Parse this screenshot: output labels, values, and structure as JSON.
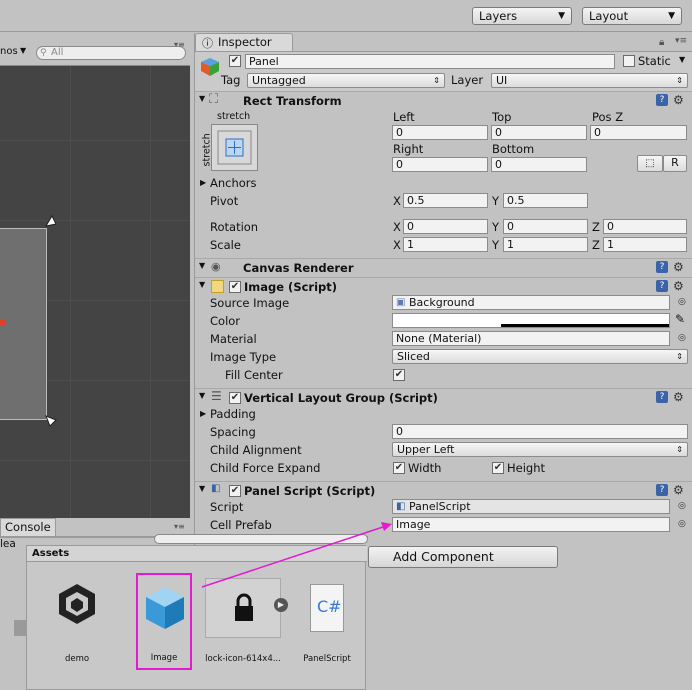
{
  "toolbar": {
    "layers_label": "Layers",
    "layout_label": "Layout"
  },
  "scene": {
    "gizmos_label": "nos",
    "search_placeholder": "All"
  },
  "inspector": {
    "tab_label": "Inspector",
    "object_name": "Panel",
    "static_label": "Static",
    "tag_label": "Tag",
    "tag_value": "Untagged",
    "layer_label": "Layer",
    "layer_value": "UI"
  },
  "rect_transform": {
    "title": "Rect Transform",
    "preset_top": "stretch",
    "preset_side": "stretch",
    "left_label": "Left",
    "left_value": "0",
    "top_label": "Top",
    "top_value": "0",
    "posz_label": "Pos Z",
    "posz_value": "0",
    "right_label": "Right",
    "right_value": "0",
    "bottom_label": "Bottom",
    "bottom_value": "0",
    "r_button": "R",
    "anchors_label": "Anchors",
    "pivot_label": "Pivot",
    "pivot_x": "0.5",
    "pivot_y": "0.5",
    "rotation_label": "Rotation",
    "rot_x": "0",
    "rot_y": "0",
    "rot_z": "0",
    "scale_label": "Scale",
    "scale_x": "1",
    "scale_y": "1",
    "scale_z": "1",
    "x": "X",
    "y": "Y",
    "z": "Z"
  },
  "canvas_renderer": {
    "title": "Canvas Renderer"
  },
  "image": {
    "title": "Image (Script)",
    "source_label": "Source Image",
    "source_value": "Background",
    "color_label": "Color",
    "material_label": "Material",
    "material_value": "None (Material)",
    "type_label": "Image Type",
    "type_value": "Sliced",
    "fill_label": "Fill Center"
  },
  "vlg": {
    "title": "Vertical Layout Group (Script)",
    "padding_label": "Padding",
    "spacing_label": "Spacing",
    "spacing_value": "0",
    "align_label": "Child Alignment",
    "align_value": "Upper Left",
    "expand_label": "Child Force Expand",
    "width_label": "Width",
    "height_label": "Height"
  },
  "panel_script": {
    "title": "Panel Script (Script)",
    "script_label": "Script",
    "script_value": "PanelScript",
    "prefab_label": "Cell Prefab",
    "prefab_value": "Image"
  },
  "add_component": "Add Component",
  "console": {
    "tab_label": "Console",
    "clear_label": "lea"
  },
  "assets": {
    "title": "Assets",
    "items": [
      "demo",
      "Image",
      "lock-icon-614x4...",
      "PanelScript"
    ]
  },
  "colors": {
    "drag_arrow": "#e21ad0",
    "help_blue": "#3a63a8"
  }
}
